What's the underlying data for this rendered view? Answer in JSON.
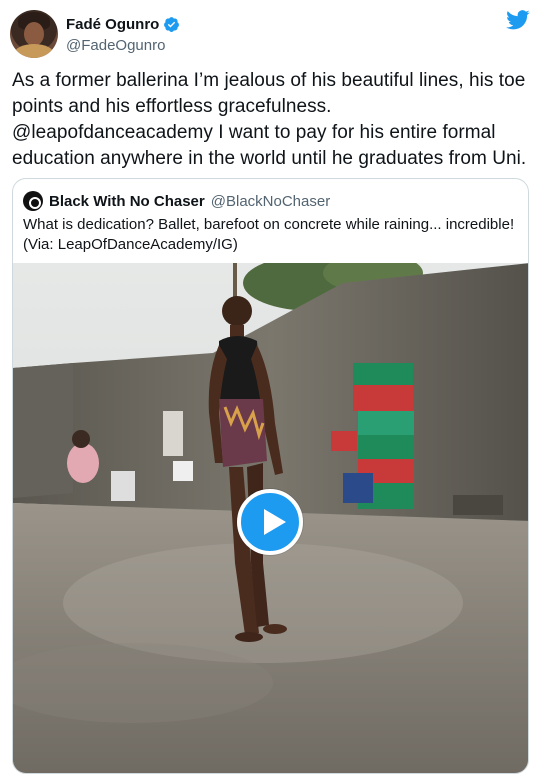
{
  "author": {
    "display_name": "Fadé Ogunro",
    "handle": "@FadeOgunro",
    "verified": true
  },
  "brand_icon": "twitter-bird-icon",
  "tweet_text": "As a former ballerina I’m jealous of his beautiful lines, his toe points and his effortless gracefulness. @leapofdanceacademy I want to pay for his entire formal education anywhere in the world until he graduates from Uni.",
  "quoted_tweet": {
    "display_name": "Black With No Chaser",
    "handle": "@BlackNoChaser",
    "text": "What is dedication? Ballet, barefoot on concrete while raining... incredible! (Via: LeapOfDanceAcademy/IG)",
    "media": {
      "type": "video",
      "play_icon": "play-icon"
    }
  },
  "colors": {
    "accent": "#1d9bf0",
    "text": "#0f1419",
    "secondary_text": "#536471",
    "border": "#cfd9de"
  }
}
